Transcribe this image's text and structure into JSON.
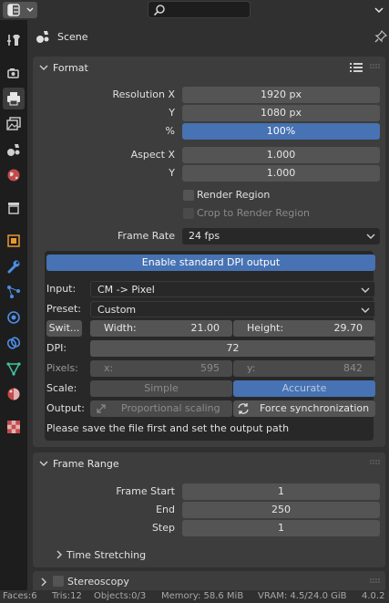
{
  "context": {
    "label": "Scene"
  },
  "format_panel": {
    "title": "Format",
    "resolution_x_label": "Resolution X",
    "resolution_x": "1920 px",
    "resolution_y_label": "Y",
    "resolution_y": "1080 px",
    "percent_label": "%",
    "percent": "100%",
    "aspect_x_label": "Aspect X",
    "aspect_x": "1.000",
    "aspect_y_label": "Y",
    "aspect_y": "1.000",
    "render_region": "Render Region",
    "crop_region": "Crop to Render Region",
    "frame_rate_label": "Frame Rate",
    "frame_rate": "24 fps"
  },
  "dpi_addon": {
    "enable_button": "Enable standard DPI output",
    "input_label": "Input:",
    "input_value": "CM -> Pixel",
    "preset_label": "Preset:",
    "preset_value": "Custom",
    "switch_button": "Swit...",
    "width_label": "Width:",
    "width_value": "21.00",
    "height_label": "Height:",
    "height_value": "29.70",
    "dpi_label": "DPI:",
    "dpi_value": "72",
    "pixels_label": "Pixels:",
    "px_x_label": "x:",
    "px_x_value": "595",
    "px_y_label": "y:",
    "px_y_value": "842",
    "scale_label": "Scale:",
    "scale_simple": "Simple",
    "scale_accurate": "Accurate",
    "output_label": "Output:",
    "proportional": "Proportional scaling",
    "force_sync": "Force synchronization",
    "message": "Please save the file first and set the output path"
  },
  "frame_range_panel": {
    "title": "Frame Range",
    "start_label": "Frame Start",
    "start": "1",
    "end_label": "End",
    "end": "250",
    "step_label": "Step",
    "step": "1",
    "time_stretching": "Time Stretching"
  },
  "stereoscopy_panel": {
    "title": "Stereoscopy"
  },
  "statusbar": {
    "faces": "Faces:6",
    "tris": "Tris:12",
    "objects": "Objects:0/3",
    "memory": "Memory: 58.6 MiB",
    "vram": "VRAM: 4.5/24.0 GiB",
    "version": "4.0.2"
  },
  "colors": {
    "accent": "#4772b3",
    "panel": "#3d3d3d",
    "field": "#545454",
    "background": "#303030"
  }
}
